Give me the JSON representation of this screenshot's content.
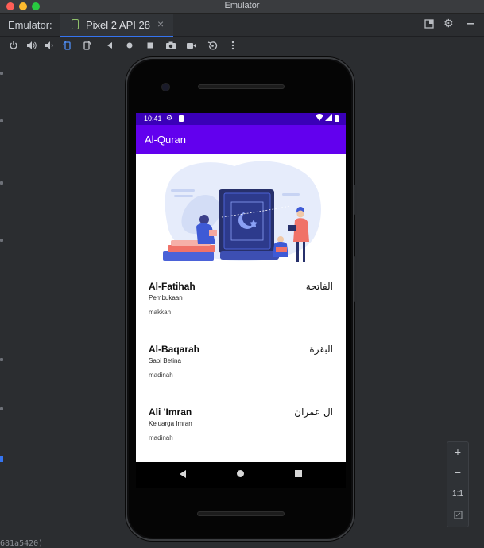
{
  "window": {
    "title": "Emulator"
  },
  "tabbar": {
    "panel_label": "Emulator:",
    "active_tab": "Pixel 2 API 28",
    "close_glyph": "×",
    "right_icons": [
      "dock-icon",
      "gear-icon",
      "minimize-icon"
    ]
  },
  "toolbar": {
    "icons": [
      "power-icon",
      "volume-up-icon",
      "volume-down-icon",
      "rotate-left-icon",
      "rotate-right-icon",
      "back-icon",
      "home-icon",
      "overview-icon",
      "camera-icon",
      "video-icon",
      "snapshot-icon",
      "more-icon"
    ]
  },
  "zoom_panel": {
    "zoom_in": "+",
    "zoom_out": "−",
    "actual_size": "1:1"
  },
  "console": {
    "tail_text": "681a5420)"
  },
  "phone": {
    "status": {
      "time": "10:41"
    },
    "appbar": {
      "title": "Al-Quran"
    },
    "surahs": [
      {
        "name": "Al-Fatihah",
        "arabic": "الفاتحة",
        "meaning": "Pembukaan",
        "place": "makkah"
      },
      {
        "name": "Al-Baqarah",
        "arabic": "البقرة",
        "meaning": "Sapi Betina",
        "place": "madinah"
      },
      {
        "name": "Ali 'Imran",
        "arabic": "ال عمران",
        "meaning": "Keluarga Imran",
        "place": "madinah"
      }
    ]
  },
  "colors": {
    "status_bar": "#3a00b8",
    "app_bar": "#6200ee",
    "ide_background": "#2b2d30",
    "tab_underline": "#3574f0"
  }
}
